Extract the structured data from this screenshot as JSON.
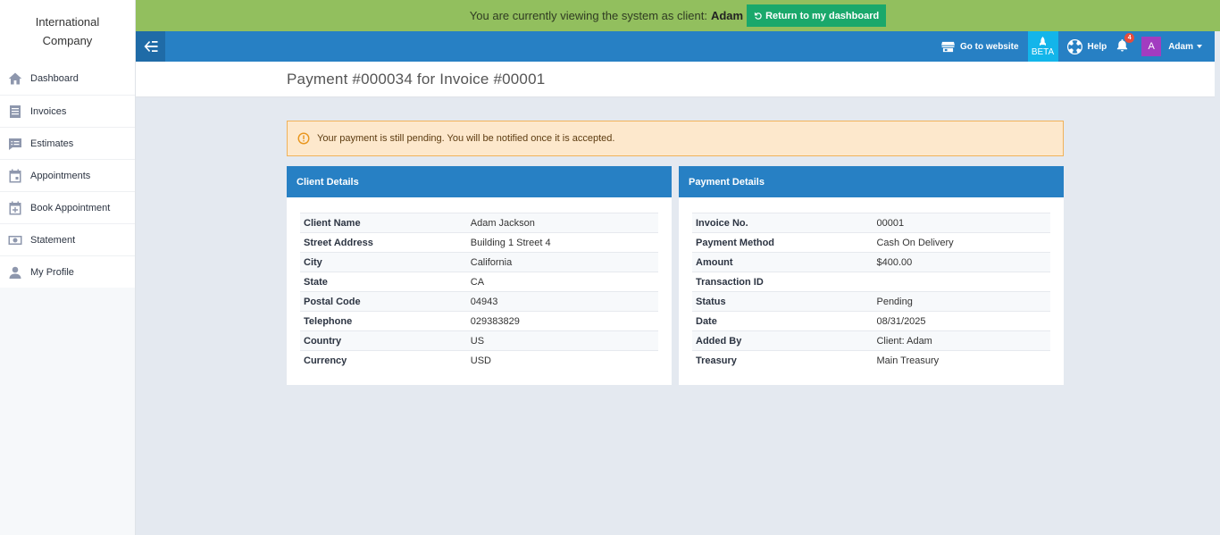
{
  "sidebar": {
    "brand": "International Company",
    "items": [
      {
        "label": "Dashboard",
        "icon": "home-icon"
      },
      {
        "label": "Invoices",
        "icon": "invoice-icon"
      },
      {
        "label": "Estimates",
        "icon": "estimate-icon"
      },
      {
        "label": "Appointments",
        "icon": "calendar-icon"
      },
      {
        "label": "Book Appointment",
        "icon": "calendar-plus-icon"
      },
      {
        "label": "Statement",
        "icon": "money-icon"
      },
      {
        "label": "My Profile",
        "icon": "user-icon"
      }
    ]
  },
  "impersonation": {
    "text": "You are currently viewing the system as client:",
    "client": "Adam",
    "return_label": "Return to my dashboard"
  },
  "topnav": {
    "website_label": "Go to website",
    "beta_label": "BETA",
    "help_label": "Help",
    "notification_count": "4",
    "avatar_letter": "A",
    "user_name": "Adam"
  },
  "page": {
    "title": "Payment #000034 for Invoice #00001"
  },
  "alert": {
    "text": "Your payment is still pending. You will be notified once it is accepted."
  },
  "client_details": {
    "title": "Client Details",
    "rows": [
      {
        "key": "Client Name",
        "value": "Adam Jackson"
      },
      {
        "key": "Street Address",
        "value": "Building 1 Street 4"
      },
      {
        "key": "City",
        "value": "California"
      },
      {
        "key": "State",
        "value": "CA"
      },
      {
        "key": "Postal Code",
        "value": "04943"
      },
      {
        "key": "Telephone",
        "value": "029383829"
      },
      {
        "key": "Country",
        "value": "US"
      },
      {
        "key": "Currency",
        "value": "USD"
      }
    ]
  },
  "payment_details": {
    "title": "Payment Details",
    "rows": [
      {
        "key": "Invoice No.",
        "value": "00001"
      },
      {
        "key": "Payment Method",
        "value": "Cash On Delivery"
      },
      {
        "key": "Amount",
        "value": "$400.00"
      },
      {
        "key": "Transaction ID",
        "value": ""
      },
      {
        "key": "Status",
        "value": "Pending"
      },
      {
        "key": "Date",
        "value": "08/31/2025"
      },
      {
        "key": "Added By",
        "value": "Client: Adam"
      },
      {
        "key": "Treasury",
        "value": "Main Treasury"
      }
    ]
  },
  "colors": {
    "impersonation_bar": "#92bf5e",
    "return_button": "#1aa86b",
    "primary": "#2780c4",
    "beta": "#13b5ea",
    "avatar": "#a23cc0",
    "alert_bg": "#fde8cc",
    "alert_border": "#f0b25a"
  }
}
